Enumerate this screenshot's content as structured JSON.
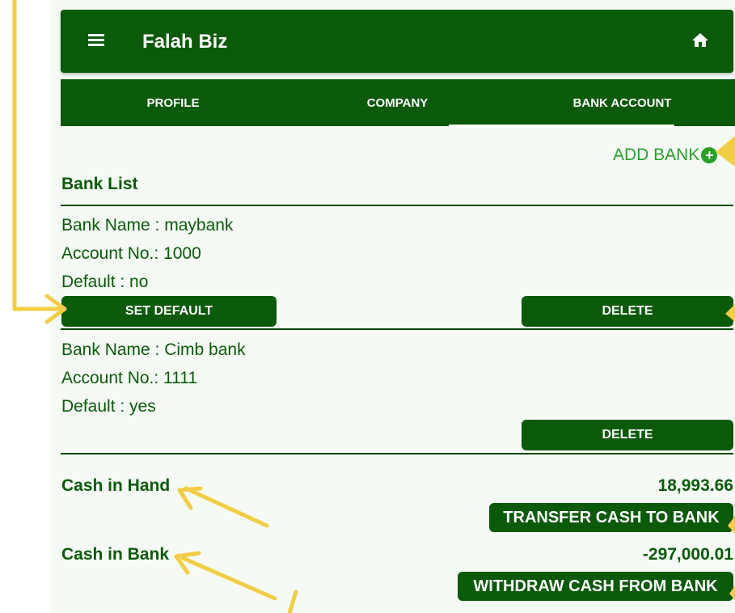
{
  "app_bar": {
    "title": "Falah Biz",
    "menu_icon": "hamburger-menu-icon",
    "home_icon": "home-icon"
  },
  "tabs": [
    {
      "label": "PROFILE",
      "selected": false
    },
    {
      "label": "COMPANY",
      "selected": false
    },
    {
      "label": "BANK ACCOUNT",
      "selected": true
    }
  ],
  "add_bank": {
    "label": "ADD BANK",
    "icon": "add-circle-icon"
  },
  "bank_list": {
    "heading": "Bank List",
    "banks": [
      {
        "name_line": "Bank Name : maybank",
        "account_line": "Account No.: 1000",
        "default_line": "Default : no",
        "set_default_label": "SET DEFAULT",
        "delete_label": "DELETE"
      },
      {
        "name_line": "Bank Name : Cimb bank",
        "account_line": "Account No.: 1111",
        "default_line": "Default : yes",
        "delete_label": "DELETE"
      }
    ]
  },
  "cash": {
    "hand_label": "Cash in Hand",
    "hand_amount": "18,993.66",
    "transfer_label": "TRANSFER CASH TO BANK",
    "bank_label": "Cash in Bank",
    "bank_amount": "-297,000.01",
    "withdraw_label": "WITHDRAW CASH FROM BANK"
  },
  "colors": {
    "primary": "#0a5a0a",
    "accent": "#27a127",
    "background": "#f5fbf4",
    "annotation": "#f2cd46"
  }
}
